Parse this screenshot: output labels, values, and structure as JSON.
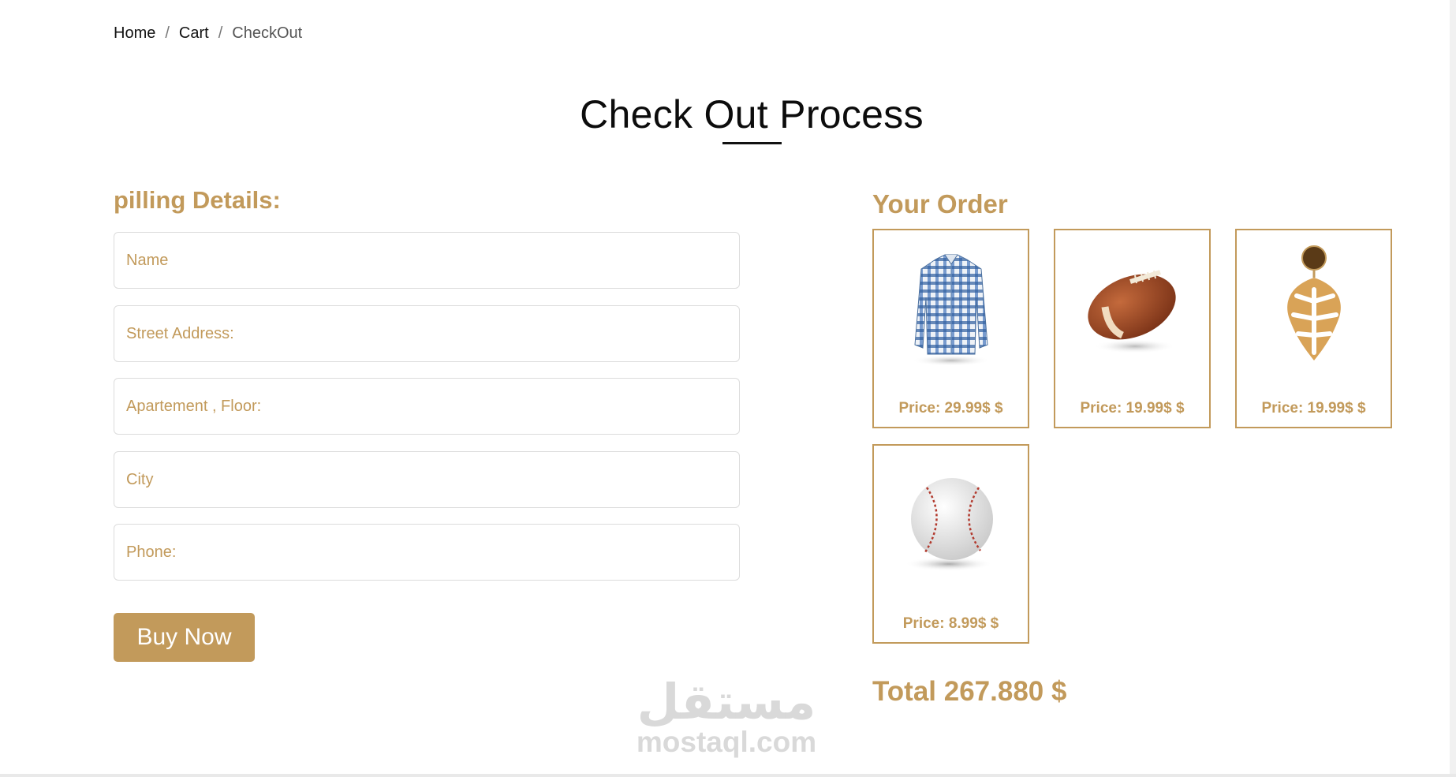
{
  "breadcrumb": {
    "home": "Home",
    "cart": "Cart",
    "current": "CheckOut",
    "separator": "/"
  },
  "page_title": "Check Out Process",
  "billing": {
    "heading": "pilling Details:",
    "fields": {
      "name": "Name",
      "street": "Street Address:",
      "apartment": "Apartement , Floor:",
      "city": "City",
      "phone": "Phone:"
    },
    "buy_label": "Buy Now"
  },
  "order": {
    "heading": "Your Order",
    "items": [
      {
        "icon": "shirt-icon",
        "price": "Price: 29.99$ $"
      },
      {
        "icon": "football-icon",
        "price": "Price: 19.99$ $"
      },
      {
        "icon": "earring-icon",
        "price": "Price: 19.99$ $"
      },
      {
        "icon": "baseball-icon",
        "price": "Price: 8.99$ $"
      }
    ],
    "total": "Total 267.880 $"
  },
  "watermark": {
    "arabic": "مستقل",
    "latin": "mostaql.com"
  },
  "colors": {
    "accent": "#c29a5b",
    "text": "#111111",
    "border": "#dcdcdc"
  }
}
